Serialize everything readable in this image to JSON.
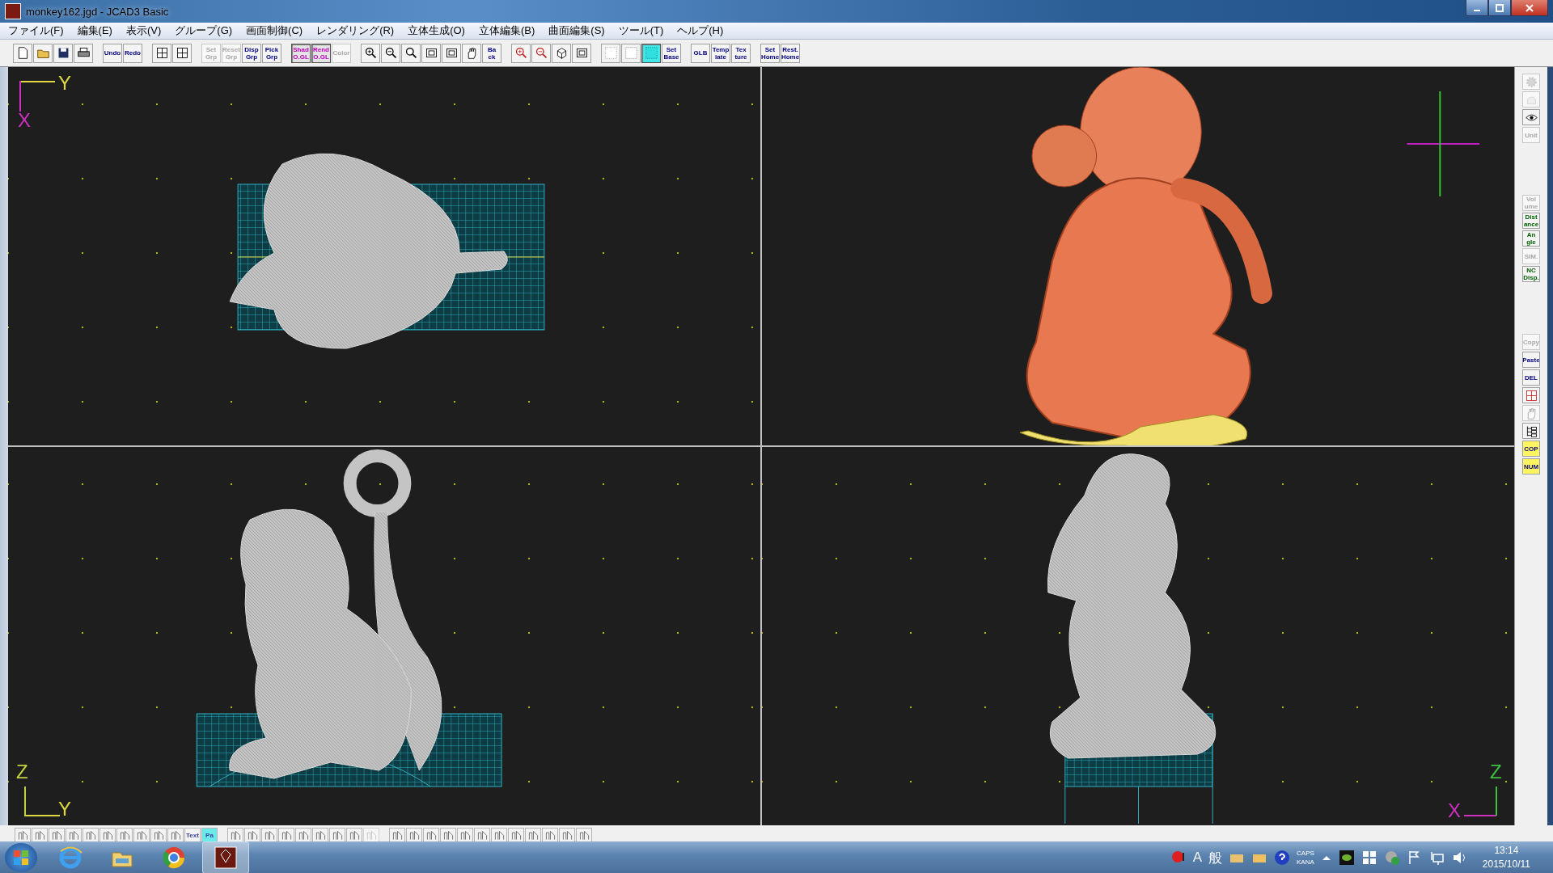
{
  "window": {
    "title": "monkey162.jgd - JCAD3 Basic"
  },
  "menu": [
    "ファイル(F)",
    "編集(E)",
    "表示(V)",
    "グループ(G)",
    "画面制御(C)",
    "レンダリング(R)",
    "立体生成(O)",
    "立体編集(B)",
    "曲面編集(S)",
    "ツール(T)",
    "ヘルプ(H)"
  ],
  "toolbar": [
    {
      "kind": "icon",
      "disabled": false,
      "active": false
    },
    {
      "kind": "icon",
      "disabled": false,
      "active": false
    },
    {
      "kind": "icon",
      "disabled": false,
      "active": false
    },
    {
      "kind": "icon",
      "disabled": false,
      "active": false
    },
    {
      "kind": "separator"
    },
    {
      "kind": "text",
      "label": "Undo",
      "disabled": false,
      "active": false
    },
    {
      "kind": "text",
      "label": "Redo",
      "disabled": false,
      "active": false
    },
    {
      "kind": "separator"
    },
    {
      "kind": "icon",
      "disabled": false,
      "active": false
    },
    {
      "kind": "icon",
      "disabled": false,
      "active": false
    },
    {
      "kind": "separator"
    },
    {
      "kind": "text",
      "label": "Set Grp",
      "disabled": true,
      "active": false
    },
    {
      "kind": "text",
      "label": "Reset Grp",
      "disabled": true,
      "active": false
    },
    {
      "kind": "text",
      "label": "Disp Grp",
      "disabled": false,
      "active": false
    },
    {
      "kind": "text",
      "label": "Pick Grp",
      "disabled": false,
      "active": false
    },
    {
      "kind": "separator"
    },
    {
      "kind": "text",
      "label": "Shad O.GL",
      "color": "#c000c0",
      "disabled": false,
      "active": true
    },
    {
      "kind": "text",
      "label": "Rend O.GL",
      "color": "#c000c0",
      "disabled": false,
      "active": true
    },
    {
      "kind": "text",
      "label": "Color",
      "disabled": true,
      "active": false
    },
    {
      "kind": "separator"
    },
    {
      "kind": "icon",
      "disabled": false,
      "active": false
    },
    {
      "kind": "icon",
      "disabled": false,
      "active": false
    },
    {
      "kind": "icon",
      "disabled": false,
      "active": false
    },
    {
      "kind": "icon",
      "disabled": false,
      "active": false
    },
    {
      "kind": "icon",
      "disabled": false,
      "active": false
    },
    {
      "kind": "icon",
      "disabled": false,
      "active": false
    },
    {
      "kind": "text",
      "label": "Ba ck",
      "disabled": false,
      "active": false
    },
    {
      "kind": "separator"
    },
    {
      "kind": "icon",
      "disabled": false,
      "active": false
    },
    {
      "kind": "icon",
      "disabled": false,
      "active": false
    },
    {
      "kind": "icon",
      "disabled": false,
      "active": false
    },
    {
      "kind": "icon",
      "disabled": false,
      "active": false
    },
    {
      "kind": "separator"
    },
    {
      "kind": "icon",
      "disabled": false,
      "active": false
    },
    {
      "kind": "icon",
      "disabled": false,
      "active": false
    },
    {
      "kind": "icon",
      "disabled": false,
      "active": true
    },
    {
      "kind": "text",
      "label": "Set Base",
      "disabled": false,
      "active": false
    },
    {
      "kind": "separator"
    },
    {
      "kind": "text",
      "label": "GLB",
      "disabled": false,
      "active": false
    },
    {
      "kind": "text",
      "label": "Temp late",
      "disabled": false,
      "active": false
    },
    {
      "kind": "text",
      "label": "Tex ture",
      "disabled": false,
      "active": false
    },
    {
      "kind": "separator"
    },
    {
      "kind": "text",
      "label": "Set Home",
      "disabled": false,
      "active": false
    },
    {
      "kind": "text",
      "label": "Rest. Home",
      "disabled": false,
      "active": false
    }
  ],
  "viewports": [
    {
      "kind": "wireframe",
      "axes": [
        {
          "kind": "horizontal",
          "label": "Y",
          "color": "#e0d840"
        },
        {
          "kind": "vertical",
          "label": "X",
          "color": "#d030c0"
        }
      ]
    },
    {
      "kind": "shaded"
    },
    {
      "kind": "wireframe",
      "axes": [
        {
          "kind": "vertical",
          "label": "Z",
          "color": "#c0d040"
        },
        {
          "kind": "horizontal",
          "label": "Y",
          "color": "#e0d840"
        }
      ]
    },
    {
      "kind": "wireframe",
      "axes": [
        {
          "kind": "vertical",
          "label": "Z",
          "color": "#40c040"
        },
        {
          "kind": "horizontal",
          "label": "X",
          "color": "#d030c0"
        }
      ]
    }
  ],
  "side_toolbar": [
    {
      "kind": "icon",
      "disabled": true,
      "active": false
    },
    {
      "kind": "icon",
      "disabled": true,
      "active": false
    },
    {
      "kind": "icon",
      "disabled": false,
      "active": false
    },
    {
      "kind": "text",
      "label": "Unit",
      "disabled": true,
      "active": false
    },
    {
      "kind": "separator"
    },
    {
      "kind": "text",
      "label": "Vol ume",
      "disabled": true,
      "active": false
    },
    {
      "kind": "text",
      "label": "Dist ance",
      "color": "#006000",
      "disabled": false,
      "active": false
    },
    {
      "kind": "text",
      "label": "An gle",
      "color": "#006000",
      "disabled": false,
      "active": false
    },
    {
      "kind": "text",
      "label": "SIM.",
      "disabled": true,
      "active": false
    },
    {
      "kind": "text",
      "label": "NC Disp.",
      "color": "#006000",
      "disabled": false,
      "active": false
    },
    {
      "kind": "separator"
    },
    {
      "kind": "text",
      "label": "Copy",
      "disabled": true,
      "active": false
    },
    {
      "kind": "text",
      "label": "Paste",
      "disabled": false,
      "active": false
    },
    {
      "kind": "text",
      "label": "DEL",
      "disabled": false,
      "active": false
    },
    {
      "kind": "icon",
      "disabled": false,
      "active": false
    },
    {
      "kind": "icon",
      "disabled": true,
      "active": false
    },
    {
      "kind": "icon",
      "disabled": false,
      "active": false
    },
    {
      "kind": "text",
      "label": "COP",
      "disabled": false,
      "active": true
    },
    {
      "kind": "text",
      "label": "NUM",
      "disabled": false,
      "active": true
    }
  ],
  "bottom_toolbar": [
    {
      "kind": "icon",
      "disabled": false,
      "active": false
    },
    {
      "kind": "icon",
      "disabled": false,
      "active": false
    },
    {
      "kind": "icon",
      "disabled": false,
      "active": false
    },
    {
      "kind": "icon",
      "disabled": false,
      "active": false
    },
    {
      "kind": "icon",
      "disabled": false,
      "active": false
    },
    {
      "kind": "icon",
      "disabled": false,
      "active": false
    },
    {
      "kind": "icon",
      "disabled": false,
      "active": false
    },
    {
      "kind": "icon",
      "disabled": false,
      "active": false
    },
    {
      "kind": "icon",
      "disabled": false,
      "active": false
    },
    {
      "kind": "icon",
      "disabled": false,
      "active": false
    },
    {
      "kind": "text",
      "label": "Text",
      "disabled": false,
      "active": false
    },
    {
      "kind": "text",
      "label": "Pa",
      "disabled": false,
      "active": true
    },
    {
      "kind": "separator"
    },
    {
      "kind": "icon",
      "disabled": false,
      "active": false
    },
    {
      "kind": "icon",
      "disabled": false,
      "active": false
    },
    {
      "kind": "icon",
      "disabled": false,
      "active": false
    },
    {
      "kind": "icon",
      "disabled": false,
      "active": false
    },
    {
      "kind": "icon",
      "disabled": false,
      "active": false
    },
    {
      "kind": "icon",
      "disabled": false,
      "active": false
    },
    {
      "kind": "icon",
      "disabled": false,
      "active": false
    },
    {
      "kind": "icon",
      "disabled": false,
      "active": false
    },
    {
      "kind": "icon",
      "disabled": true,
      "active": false
    },
    {
      "kind": "separator"
    },
    {
      "kind": "icon",
      "disabled": false,
      "active": false
    },
    {
      "kind": "icon",
      "disabled": false,
      "active": false
    },
    {
      "kind": "icon",
      "disabled": false,
      "active": false
    },
    {
      "kind": "icon",
      "disabled": false,
      "active": false
    },
    {
      "kind": "icon",
      "disabled": false,
      "active": false
    },
    {
      "kind": "icon",
      "disabled": false,
      "active": false
    },
    {
      "kind": "icon",
      "disabled": false,
      "active": false
    },
    {
      "kind": "icon",
      "disabled": false,
      "active": false
    },
    {
      "kind": "icon",
      "disabled": false,
      "active": false
    },
    {
      "kind": "icon",
      "disabled": false,
      "active": false
    },
    {
      "kind": "icon",
      "disabled": false,
      "active": false
    },
    {
      "kind": "icon",
      "disabled": false,
      "active": false
    }
  ],
  "taskbar": {
    "apps": [
      {
        "selected": false
      },
      {
        "selected": false
      },
      {
        "selected": false
      },
      {
        "selected": true
      }
    ],
    "ime_mode": "A",
    "ime_name": "般",
    "caps": "CAPS",
    "kana": "KANA",
    "time": "13:14",
    "date": "2015/10/11"
  }
}
